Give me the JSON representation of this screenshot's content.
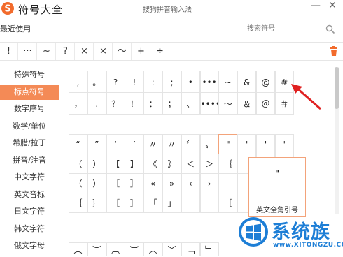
{
  "title_bar": {
    "title": "符号大全",
    "subtitle": "搜狗拼音输入法",
    "minimize": "—",
    "close": "✕"
  },
  "recent": {
    "label": "最近使用",
    "symbols": [
      "!",
      "···",
      "~",
      "?",
      "×",
      "×",
      "～",
      "+",
      "÷"
    ]
  },
  "search": {
    "placeholder": "搜索符号"
  },
  "sidebar": {
    "items": [
      {
        "label": "特殊符号"
      },
      {
        "label": "标点符号",
        "active": true
      },
      {
        "label": "数字序号"
      },
      {
        "label": "数学/单位"
      },
      {
        "label": "希腊/拉丁"
      },
      {
        "label": "拼音/注音"
      },
      {
        "label": "中文字符"
      },
      {
        "label": "英文音标"
      },
      {
        "label": "日文字符"
      },
      {
        "label": "韩文字符"
      },
      {
        "label": "俄文字母"
      }
    ]
  },
  "grid1": [
    [
      ",",
      "。",
      "?",
      "!",
      ":",
      ";",
      "•",
      "•••",
      "~",
      "&",
      "@",
      "#"
    ],
    [
      "，",
      ".",
      "？",
      "！",
      "：",
      "；",
      "、",
      "••••••",
      "～",
      "＆",
      "＠",
      "＃"
    ]
  ],
  "grid2": [
    [
      "“",
      "”",
      "‘",
      "’",
      "〃",
      "〃",
      "〞",
      "〟",
      "\"",
      "'",
      "'",
      "'"
    ],
    [
      "（",
      "）",
      "【",
      "】",
      "《",
      "》",
      "＜",
      "＞",
      "｛",
      "",
      "",
      "〉"
    ],
    [
      "（",
      "）",
      "［",
      "］",
      "«",
      "»",
      "‹",
      "›",
      "",
      "",
      "",
      "〉"
    ],
    [
      "｛",
      "｝",
      "［",
      "］",
      "「",
      "」",
      "",
      "",
      "［",
      "",
      "",
      "』"
    ]
  ],
  "grid3": [
    "︵",
    "︶",
    "︹",
    "︺",
    "︿",
    "﹀",
    "﹁",
    "﹂"
  ],
  "popup": {
    "char": "\"",
    "label": "英文全角引号"
  },
  "watermark": {
    "name": "系统族",
    "url": "www.XITONGZU.COM"
  },
  "colors": {
    "accent": "#f48a56",
    "highlight_border": "#f3a37a",
    "arrow": "#e02020",
    "watermark": "#1d7ed6"
  }
}
